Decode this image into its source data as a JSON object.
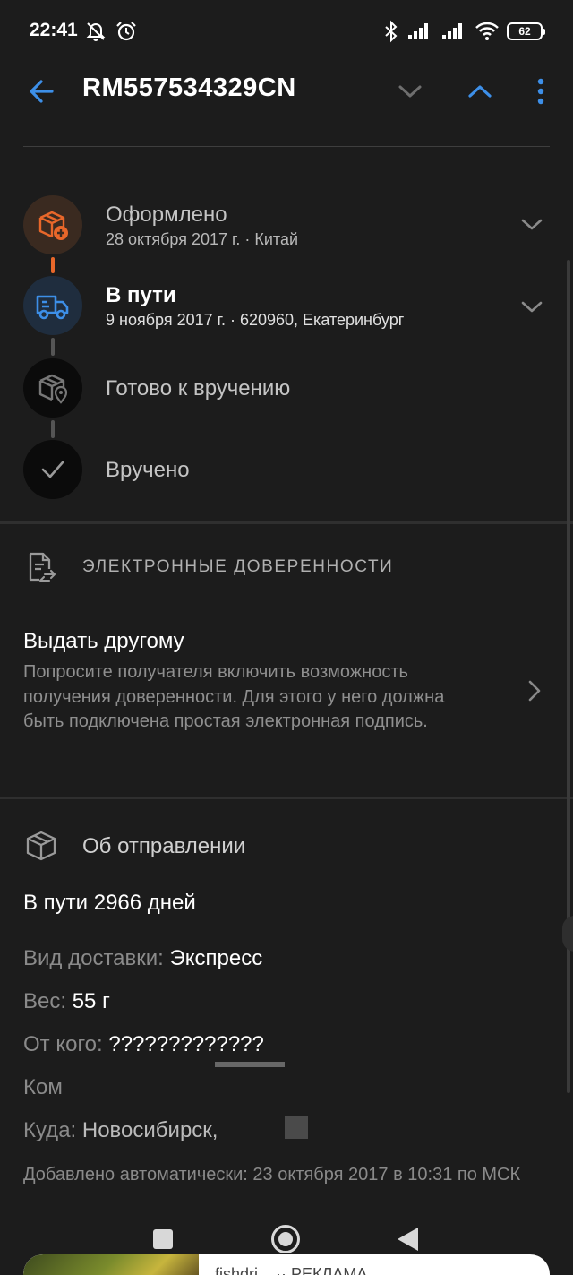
{
  "status_bar": {
    "time": "22:41",
    "battery": "62",
    "icons": [
      "mute-icon",
      "alarm-icon",
      "bluetooth-icon",
      "signal-icon",
      "signal-icon",
      "wifi-icon",
      "battery-icon"
    ]
  },
  "app_bar": {
    "title": "RM557534329CN",
    "accent_color": "#3d8fe8"
  },
  "timeline": [
    {
      "title": "Оформлено",
      "subtitle": "28 октября 2017 г. · Китай",
      "icon": "package-add-icon",
      "state": "done",
      "color": "#e8672a"
    },
    {
      "title": "В пути",
      "subtitle": "9 ноября 2017 г. · 620960, Екатеринбург",
      "icon": "truck-icon",
      "state": "current",
      "color": "#3d8fe8"
    },
    {
      "title": "Готово к вручению",
      "subtitle": "",
      "icon": "package-location-icon",
      "state": "pending"
    },
    {
      "title": "Вручено",
      "subtitle": "",
      "icon": "checkmark-icon",
      "state": "pending"
    }
  ],
  "proxy_section": {
    "caption": "ЭЛЕКТРОННЫЕ ДОВЕРЕННОСТИ",
    "title": "Выдать другому",
    "description": "Попросите получателя включить возможность получения доверенности. Для этого у него должна быть подключена простая электронная подпись."
  },
  "shipment_section": {
    "heading": "Об отправлении",
    "days": "В пути 2966 дней",
    "rows": [
      {
        "label": "Вид доставки:",
        "value": "Экспресс"
      },
      {
        "label": "Вес:",
        "value": "55 г"
      },
      {
        "label": "От кого:",
        "value": "?????????????"
      },
      {
        "label": "Ком",
        "value": ""
      },
      {
        "label": "Куда:",
        "value": "Новосибирск,"
      }
    ],
    "added": "Добавлено автоматически: 23 октября 2017 в 10:31 по МСК"
  },
  "ad_banner": {
    "text": "fishdri... ·· РЕКЛАМА"
  }
}
